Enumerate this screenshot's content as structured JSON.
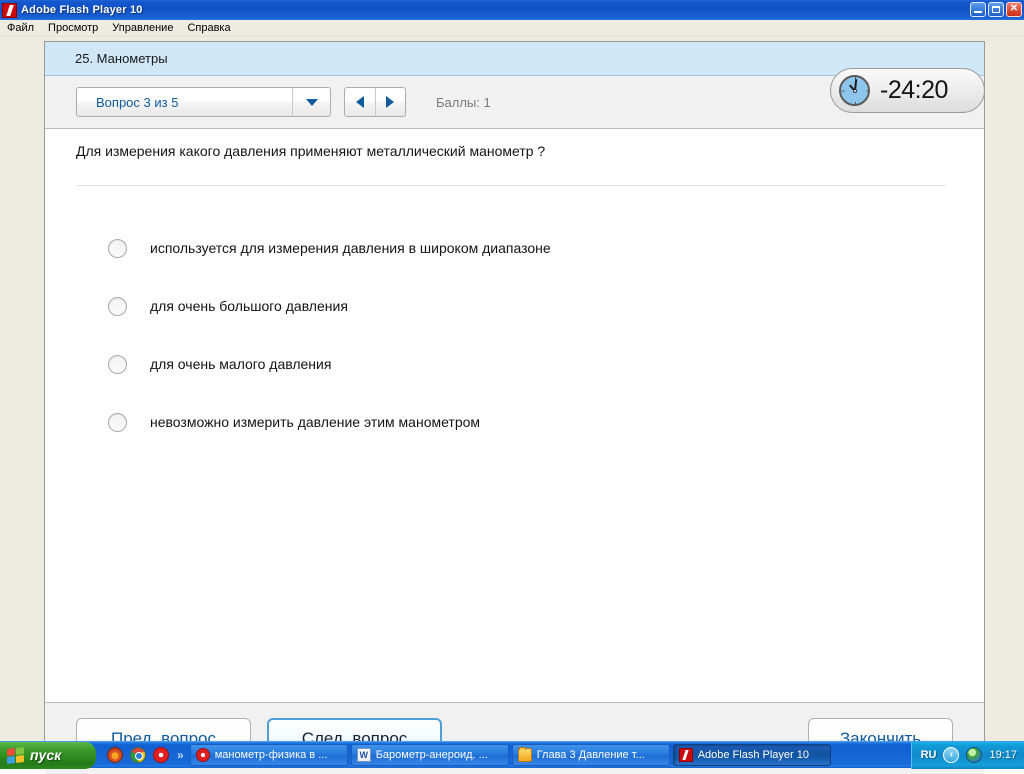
{
  "window": {
    "title": "Adobe Flash Player 10",
    "app_icon": "flash-icon",
    "controls": {
      "minimize": "minimize-icon",
      "maximize": "restore-icon",
      "close": "✕"
    }
  },
  "menubar": {
    "items": [
      {
        "label": "Файл"
      },
      {
        "label": "Просмотр"
      },
      {
        "label": "Управление"
      },
      {
        "label": "Справка"
      }
    ]
  },
  "quiz": {
    "header_title": "25. Манометры",
    "toolbar": {
      "question_selector_value": "Вопрос 3 из 5",
      "prev_arrow_icon": "triangle-left-icon",
      "next_arrow_icon": "triangle-right-icon",
      "dropdown_icon": "chevron-down-icon",
      "score_label": "Баллы: 1"
    },
    "timer": {
      "icon": "clock-icon",
      "value": "-24:20"
    },
    "question": "Для измерения какого давления применяют металлический манометр ?",
    "options": [
      {
        "label": "используется для измерения давления в широком диапазоне",
        "selected": false
      },
      {
        "label": "для очень большого давления",
        "selected": false
      },
      {
        "label": "для очень малого давления",
        "selected": false
      },
      {
        "label": "невозможно измерить давление этим манометром",
        "selected": false
      }
    ],
    "footer": {
      "prev_label": "Пред. вопрос",
      "next_label": "След. вопрос",
      "finish_label": "Закончить"
    }
  },
  "taskbar": {
    "start_label": "пуск",
    "quicklaunch": [
      {
        "icon": "firefox-icon"
      },
      {
        "icon": "chrome-icon"
      },
      {
        "icon": "opera-icon"
      }
    ],
    "quicklaunch_more": "»",
    "tasks": [
      {
        "icon": "opera-icon",
        "label": "манометр-физика в ...",
        "active": false
      },
      {
        "icon": "word-icon",
        "label": "Барометр-анероид. ...",
        "active": false
      },
      {
        "icon": "folder-icon",
        "label": "Глава 3 Давление т...",
        "active": false
      },
      {
        "icon": "flash-icon",
        "label": "Adobe Flash Player 10",
        "active": true
      }
    ],
    "tray": {
      "language": "RU",
      "chevron_icon": "chevron-left-icon",
      "network_icon": "globe-icon",
      "clock": "19:17"
    }
  },
  "colors": {
    "titlebar_blue": "#1558cd",
    "header_band": "#cfe7f7",
    "accent_link": "#0f5b9e",
    "stage_bg": "#eeece1",
    "focus_border": "#4d9fd6"
  }
}
